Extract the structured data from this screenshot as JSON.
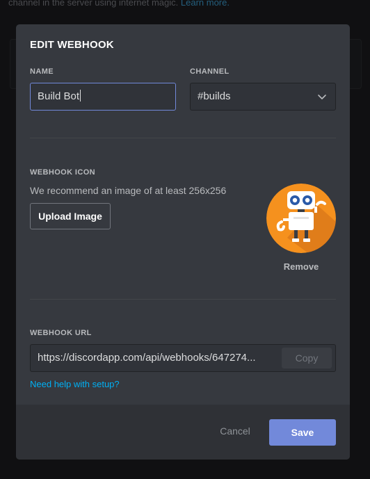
{
  "background": {
    "text": "channel in the server using internet magic.",
    "link": "Learn more."
  },
  "modal": {
    "title": "EDIT WEBHOOK",
    "name_label": "NAME",
    "name_value": "Build Bot",
    "channel_label": "CHANNEL",
    "channel_value": "#builds",
    "icon_label": "WEBHOOK ICON",
    "icon_help": "We recommend an image of at least 256x256",
    "upload_button": "Upload Image",
    "remove_label": "Remove",
    "url_label": "WEBHOOK URL",
    "url_value": "https://discordapp.com/api/webhooks/647274...",
    "copy_button": "Copy",
    "help_link": "Need help with setup?"
  },
  "footer": {
    "cancel": "Cancel",
    "save": "Save"
  },
  "colors": {
    "accent": "#7289da",
    "link": "#00b0f4",
    "modal_bg": "#36393f",
    "footer_bg": "#2f3136",
    "avatar_orange": "#f5911e"
  },
  "icons": {
    "channel_select": "chevron-down-icon",
    "avatar": "robot-icon"
  }
}
